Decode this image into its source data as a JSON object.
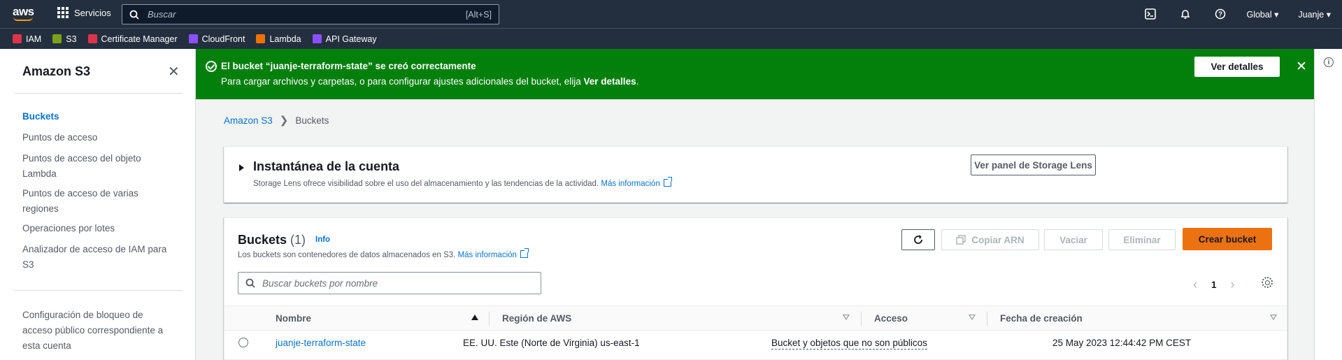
{
  "topnav": {
    "logo": "aws",
    "services_label": "Servicios",
    "search_placeholder": "Buscar",
    "search_shortcut": "[Alt+S]",
    "region": "Global",
    "user": "Juanje"
  },
  "favorites": [
    {
      "label": "IAM",
      "color": "#dd344c"
    },
    {
      "label": "S3",
      "color": "#7aa116"
    },
    {
      "label": "Certificate Manager",
      "color": "#dd344c"
    },
    {
      "label": "CloudFront",
      "color": "#8c4fff"
    },
    {
      "label": "Lambda",
      "color": "#ed7100"
    },
    {
      "label": "API Gateway",
      "color": "#8c4fff"
    }
  ],
  "sidebar": {
    "title": "Amazon S3",
    "items": [
      {
        "label": "Buckets",
        "active": true
      },
      {
        "label": "Puntos de acceso"
      },
      {
        "label": "Puntos de acceso del objeto Lambda"
      },
      {
        "label": "Puntos de acceso de varias regiones"
      },
      {
        "label": "Operaciones por lotes"
      },
      {
        "label": "Analizador de acceso de IAM para S3"
      }
    ],
    "bottom_item": "Configuración de bloqueo de acceso público correspondiente a esta cuenta"
  },
  "flash": {
    "title": "El bucket “juanje-terraform-state” se creó correctamente",
    "message_prefix": "Para cargar archivos y carpetas, o para configurar ajustes adicionales del bucket, elija ",
    "message_strong": "Ver detalles",
    "message_suffix": ".",
    "button": "Ver detalles",
    "color": "#037f0c"
  },
  "breadcrumb": {
    "root": "Amazon S3",
    "current": "Buckets"
  },
  "snapshot": {
    "title": "Instantánea de la cuenta",
    "description": "Storage Lens ofrece visibilidad sobre el uso del almacenamiento y las tendencias de la actividad.",
    "link": "Más información",
    "button": "Ver panel de Storage Lens"
  },
  "buckets": {
    "title": "Buckets",
    "count": "(1)",
    "info": "Info",
    "description": "Los buckets son contenedores de datos almacenados en S3.",
    "link": "Más información",
    "buttons": {
      "copy_arn": "Copiar ARN",
      "empty": "Vaciar",
      "delete": "Eliminar",
      "create": "Crear bucket"
    },
    "search_placeholder": "Buscar buckets por nombre",
    "page": "1",
    "columns": [
      "Nombre",
      "Región de AWS",
      "Acceso",
      "Fecha de creación"
    ],
    "rows": [
      {
        "name": "juanje-terraform-state",
        "region": "EE. UU. Este (Norte de Virginia) us-east-1",
        "access": "Bucket y objetos que no son públicos",
        "created": "25 May 2023 12:44:42 PM CEST"
      }
    ]
  },
  "accent_color": "#ec7211",
  "link_color": "#0972d3"
}
